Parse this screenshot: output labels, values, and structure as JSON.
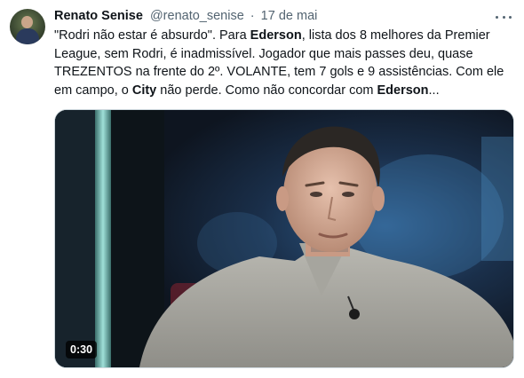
{
  "tweet": {
    "author_name": "Renato Senise",
    "author_handle": "@renato_senise",
    "separator": "·",
    "date": "17 de mai",
    "text_parts": [
      {
        "t": "\"Rodri não estar é absurdo\". Para ",
        "b": false
      },
      {
        "t": "Ederson",
        "b": true
      },
      {
        "t": ", lista dos 8 melhores da Premier League, sem Rodri, é inadmissível. Jogador que mais passes deu, quase TREZENTOS na frente do 2º. VOLANTE, tem 7 gols e 9 assistências. Com ele em campo, o ",
        "b": false
      },
      {
        "t": "City",
        "b": true
      },
      {
        "t": " não perde. Como não concordar com ",
        "b": false
      },
      {
        "t": "Ederson",
        "b": true
      },
      {
        "t": "...",
        "b": false
      }
    ],
    "media": {
      "type": "video",
      "duration": "0:30"
    }
  },
  "icons": {
    "more": "more-horizontal-icon",
    "avatar": "avatar"
  },
  "colors": {
    "text": "#0f1419",
    "secondary_text": "#536471",
    "border": "#cfd9de"
  }
}
